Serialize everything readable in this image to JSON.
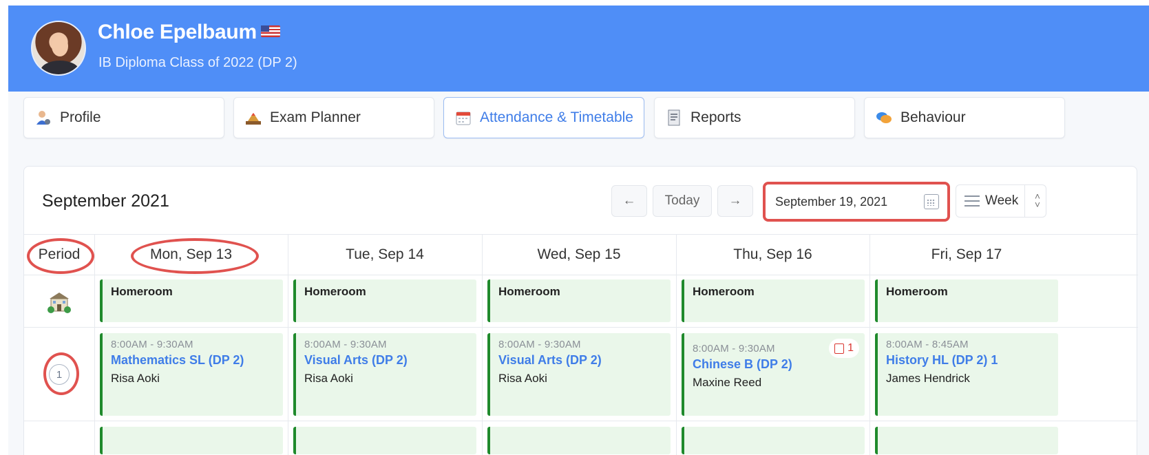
{
  "header": {
    "name": "Chloe Epelbaum",
    "flag_icon": "us-flag-icon",
    "subtitle": "IB Diploma Class of 2022 (DP 2)",
    "background_color": "#4f8ef7"
  },
  "tabs": [
    {
      "label": "Profile",
      "icon": "profile-icon",
      "active": false
    },
    {
      "label": "Exam Planner",
      "icon": "exam-planner-icon",
      "active": false
    },
    {
      "label": "Attendance & Timetable",
      "icon": "calendar-icon",
      "active": true
    },
    {
      "label": "Reports",
      "icon": "report-icon",
      "active": false
    },
    {
      "label": "Behaviour",
      "icon": "behaviour-icon",
      "active": false
    }
  ],
  "calendar": {
    "month_title": "September 2021",
    "prev_label": "←",
    "today_label": "Today",
    "next_label": "→",
    "date_value": "September 19, 2021",
    "view_label": "Week",
    "period_header": "Period",
    "days": [
      "Mon, Sep 13",
      "Tue, Sep 14",
      "Wed, Sep 15",
      "Thu, Sep 16",
      "Fri, Sep 17"
    ],
    "homeroom_row": {
      "period_icon": "school-building-icon",
      "label": "Homeroom"
    },
    "period_1": {
      "number": "1",
      "slots": [
        {
          "time": "8:00AM - 9:30AM",
          "subject": "Mathematics SL (DP 2)",
          "teacher": "Risa Aoki"
        },
        {
          "time": "8:00AM - 9:30AM",
          "subject": "Visual Arts (DP 2)",
          "teacher": "Risa Aoki"
        },
        {
          "time": "8:00AM - 9:30AM",
          "subject": "Visual Arts (DP 2)",
          "teacher": "Risa Aoki"
        },
        {
          "time": "8:00AM - 9:30AM",
          "subject": "Chinese B (DP 2)",
          "teacher": "Maxine Reed",
          "badge": "1"
        },
        {
          "time": "8:00AM - 8:45AM",
          "subject": "History HL (DP 2) 1",
          "teacher": "James Hendrick"
        }
      ]
    }
  },
  "colors": {
    "accent": "#3f7de8",
    "slot_bg": "#eaf7ea",
    "slot_border": "#1f8a2c",
    "annotation_red": "#e0524f"
  }
}
